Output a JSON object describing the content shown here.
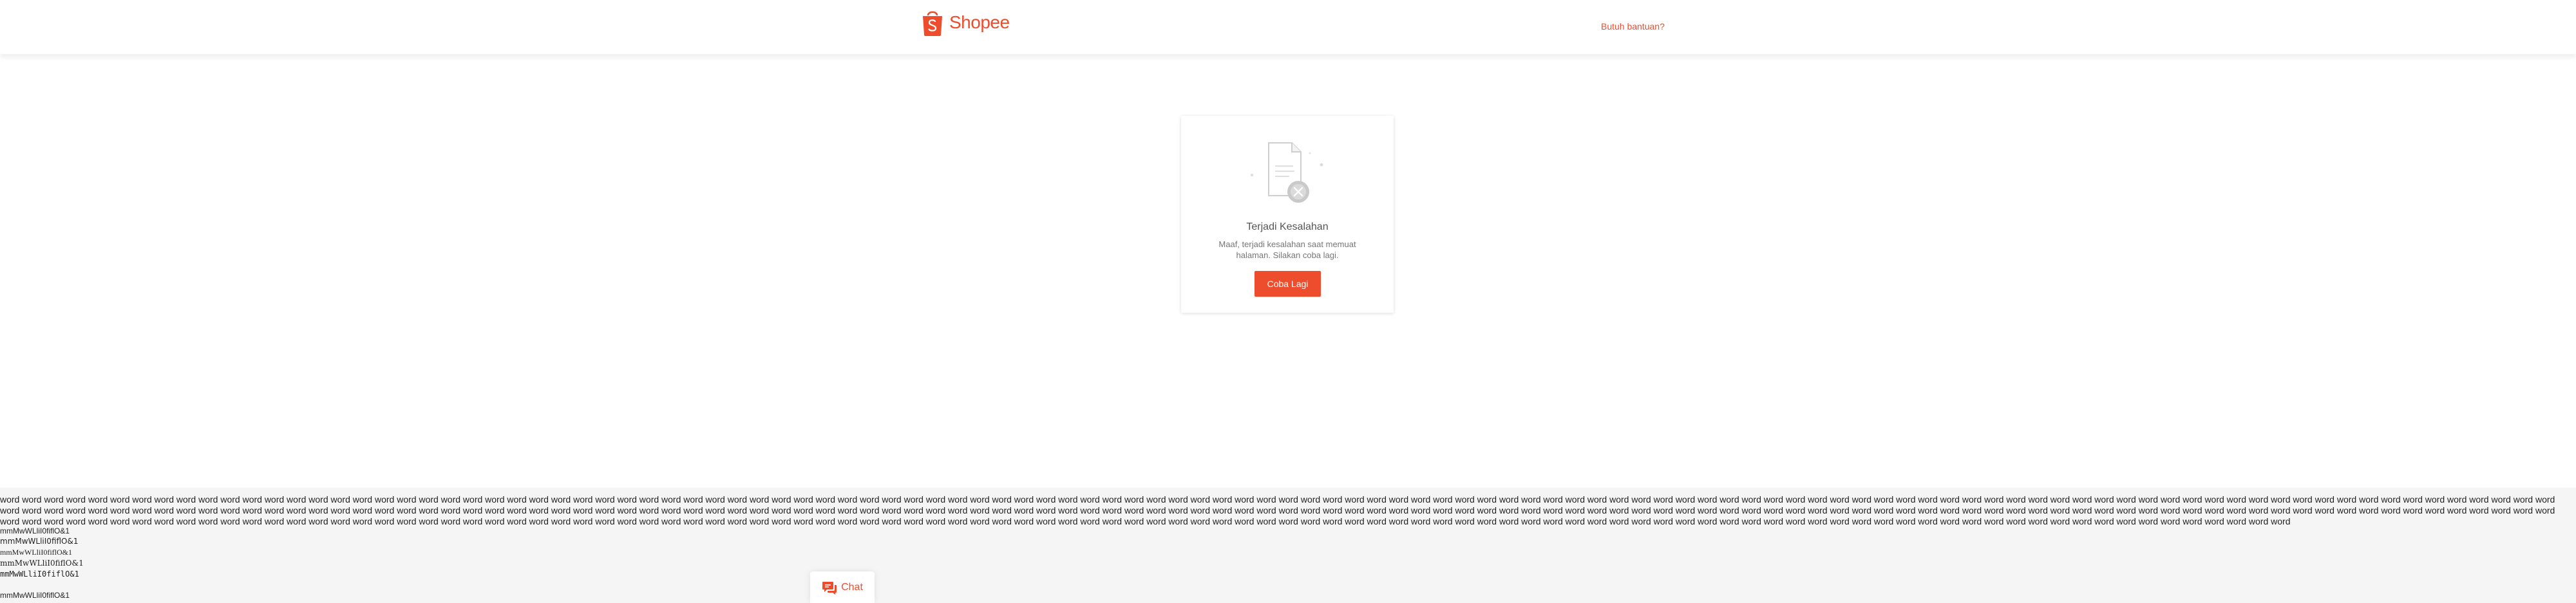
{
  "header": {
    "brand": "Shopee",
    "help_link": "Butuh bantuan?"
  },
  "error_card": {
    "title": "Terjadi Kesalahan",
    "message": "Maaf, terjadi kesalahan saat memuat halaman. Silakan coba lagi.",
    "retry_label": "Coba Lagi"
  },
  "font_test": {
    "words": "word word word word word word word word word word word word word word word word word word word word word word word word word word word word word word word word word word word word word word word word word word word word word word word word word word word word word word word word word word word word word word word word word word word word word word word word word word word word word word word word word word word word word word word word word word word word word word word word word word word word word word word word word word word word word word word word word word word word word word word word word word word word word word word word word word word word word word word word word word word word word word word word word word word word word word word word word word word word word word word word word word word word word word word word word word word word word word word word word word word word word word word word word word word word word word word word word word word word word word word word word word word word word word word word word word word word word word word word word word word word word word word word word word word word word word word word word word word word word word word word word word word word word word word word word word word word word word word word word word word word word word word word word word word word word word word word word word word word word word word word word word word word word word word word word word word word word word word word word word word word word word word word word word word word word word word word word word word word word word word word word word word word word word word word word word word word word word word word",
    "glyph_lines": [
      "mmMwWLliI0fiflO&1",
      "mmMwWLliI0fiflO&1",
      "mmMwWLliI0fiflO&1",
      "mmMwWLliI0fiflO&1",
      "mmMwWLliI0fiflO&1",
      "mmMwWLliI0fiflO&1"
    ]
  },
  "chat": {
    "label": "Chat"
  },
  "colors": {
    "brand": "#ee4d2d",
    "footer_bg": "#f5f5f5"
  },
  "icons": {
    "logo": "shopee-bag-icon",
    "illustration": "document-error-icon",
    "chat": "chat-bubble-icon"
  }
}
